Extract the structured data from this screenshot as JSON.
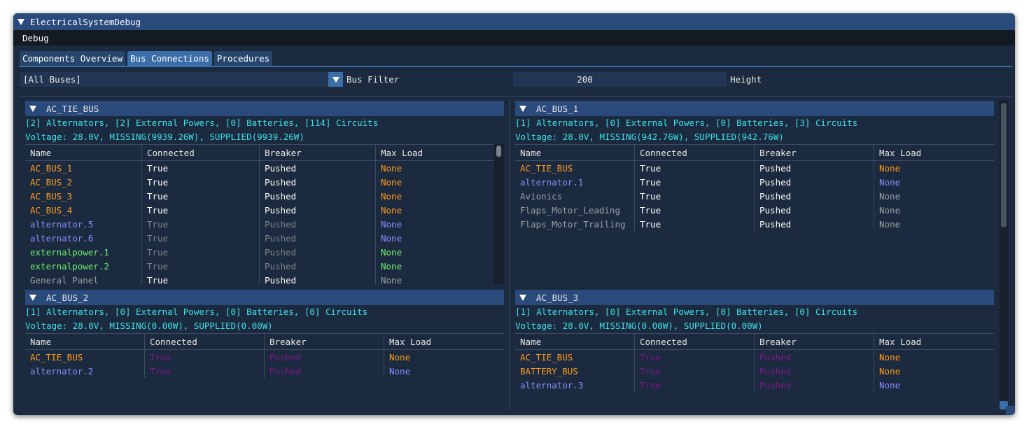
{
  "window": {
    "title": "ElectricalSystemDebug"
  },
  "menu": {
    "debug": "Debug"
  },
  "tabs": [
    "Components Overview",
    "Bus Connections",
    "Procedures"
  ],
  "filter": {
    "bus_value": "[All Buses]",
    "bus_label": "Bus Filter",
    "height_value": "200",
    "height_label": "Height"
  },
  "columns": [
    "Name",
    "Connected",
    "Breaker",
    "Max Load"
  ],
  "buses": {
    "ac_tie_bus": {
      "title": "AC_TIE_BUS",
      "summary": "[2] Alternators, [2] External Powers, [0] Batteries, [114] Circuits",
      "voltage": "Voltage: 28.0V, MISSING(9939.26W), SUPPLIED(9939.26W)",
      "rows": [
        [
          "AC_BUS_1",
          "True",
          "Pushed",
          "None"
        ],
        [
          "AC_BUS_2",
          "True",
          "Pushed",
          "None"
        ],
        [
          "AC_BUS_3",
          "True",
          "Pushed",
          "None"
        ],
        [
          "AC_BUS_4",
          "True",
          "Pushed",
          "None"
        ],
        [
          "alternator.5",
          "True",
          "Pushed",
          "None"
        ],
        [
          "alternator.6",
          "True",
          "Pushed",
          "None"
        ],
        [
          "externalpower.1",
          "True",
          "Pushed",
          "None"
        ],
        [
          "externalpower.2",
          "True",
          "Pushed",
          "None"
        ],
        [
          "General_Panel",
          "True",
          "Pushed",
          "None"
        ]
      ]
    },
    "ac_bus_1": {
      "title": "AC_BUS_1",
      "summary": "[1] Alternators, [0] External Powers, [0] Batteries, [3] Circuits",
      "voltage": "Voltage: 28.0V, MISSING(942.76W), SUPPLIED(942.76W)",
      "rows": [
        [
          "AC_TIE_BUS",
          "True",
          "Pushed",
          "None"
        ],
        [
          "alternator.1",
          "True",
          "Pushed",
          "None"
        ],
        [
          "Avionics",
          "True",
          "Pushed",
          "None"
        ],
        [
          "Flaps_Motor_Leading",
          "True",
          "Pushed",
          "None"
        ],
        [
          "Flaps_Motor_Trailing",
          "True",
          "Pushed",
          "None"
        ]
      ]
    },
    "ac_bus_2": {
      "title": "AC_BUS_2",
      "summary": "[1] Alternators, [0] External Powers, [0] Batteries, [0] Circuits",
      "voltage": "Voltage: 28.0V, MISSING(0.00W), SUPPLIED(0.00W)",
      "rows": [
        [
          "AC_TIE_BUS",
          "True",
          "Pushed",
          "None"
        ],
        [
          "alternator.2",
          "True",
          "Pushed",
          "None"
        ]
      ]
    },
    "ac_bus_3": {
      "title": "AC_BUS_3",
      "summary": "[1] Alternators, [0] External Powers, [0] Batteries, [0] Circuits",
      "voltage": "Voltage: 28.0V, MISSING(0.00W), SUPPLIED(0.00W)",
      "rows": [
        [
          "AC_TIE_BUS",
          "True",
          "Pushed",
          "None"
        ],
        [
          "BATTERY_BUS",
          "True",
          "Pushed",
          "None"
        ],
        [
          "alternator.3",
          "True",
          "Pushed",
          "None"
        ]
      ]
    }
  },
  "colors": {
    "bus": "#ff9a1e",
    "alternator": "#8c8cff",
    "external_power": "#6ef06e",
    "circuit": "#9aa0a6",
    "info": "#3fe0e8",
    "unpowered": "#7a1a8c",
    "header": "#2a4a7c"
  }
}
